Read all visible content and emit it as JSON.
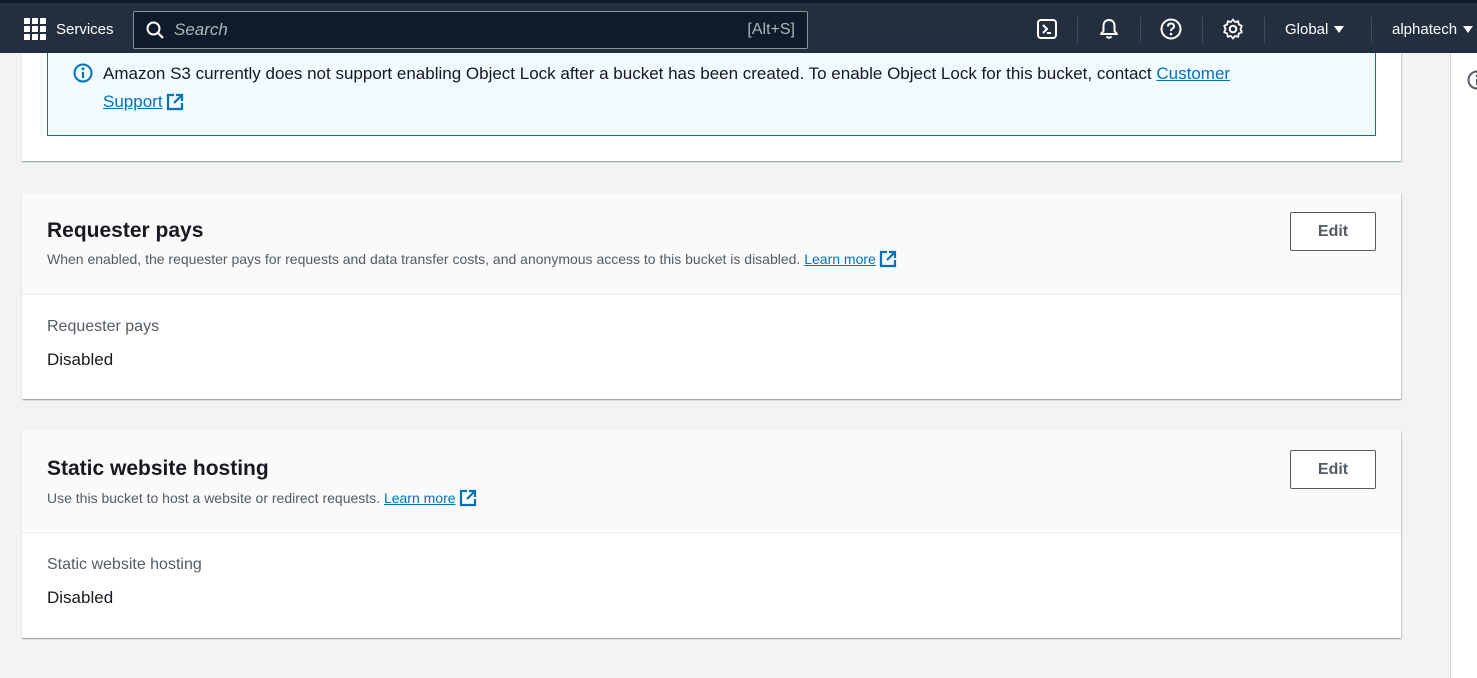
{
  "nav": {
    "services_label": "Services",
    "search_placeholder": "Search",
    "search_shortcut": "[Alt+S]",
    "region_label": "Global",
    "account_label": "alphatech"
  },
  "object_lock_alert": {
    "text": "Amazon S3 currently does not support enabling Object Lock after a bucket has been created. To enable Object Lock for this bucket, contact ",
    "link_part1": "Customer",
    "link_part2": "Support"
  },
  "requester_pays": {
    "title": "Requester pays",
    "description": "When enabled, the requester pays for requests and data transfer costs, and anonymous access to this bucket is disabled. ",
    "learn_more": "Learn more",
    "edit_label": "Edit",
    "field_label": "Requester pays",
    "field_value": "Disabled"
  },
  "static_website_hosting": {
    "title": "Static website hosting",
    "description": "Use this bucket to host a website or redirect requests. ",
    "learn_more": "Learn more",
    "edit_label": "Edit",
    "field_label": "Static website hosting",
    "field_value": "Disabled"
  },
  "colors": {
    "nav_bg": "#232f3e",
    "link": "#0073bb",
    "alert_bg": "#f1faff"
  },
  "icons": [
    "grid-icon",
    "search-icon",
    "cloudshell-icon",
    "bell-icon",
    "help-icon",
    "settings-icon",
    "info-icon",
    "external-link-icon"
  ]
}
